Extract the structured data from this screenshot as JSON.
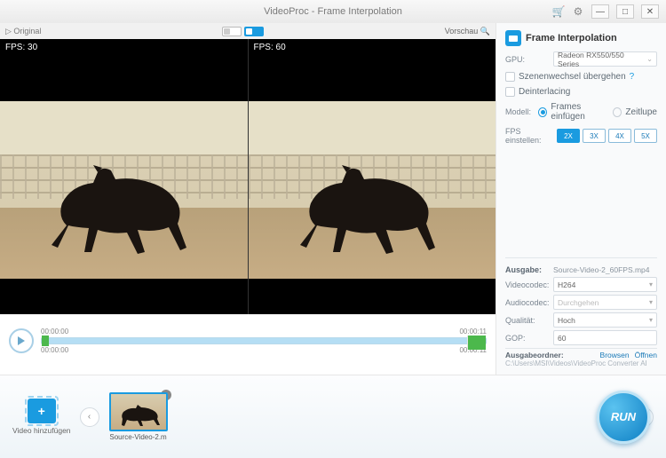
{
  "title": "VideoProc - Frame Interpolation",
  "compare": {
    "original": "Original",
    "preview": "Vorschau"
  },
  "previews": {
    "left_fps": "FPS: 30",
    "right_fps": "FPS: 60"
  },
  "timeline": {
    "start": "00:00:00",
    "end": "00:00:11",
    "sub_start": "00:00:00",
    "sub_end": "00:00:11"
  },
  "panel": {
    "title": "Frame Interpolation",
    "gpu_label": "GPU:",
    "gpu_value": "Radeon RX550/550 Series",
    "scene_skip": "Szenenwechsel übergehen",
    "deinterlacing": "Deinterlacing",
    "model_label": "Modell:",
    "model_insert": "Frames einfügen",
    "model_slowmo": "Zeitlupe",
    "fps_label": "FPS einstellen:",
    "fps_options": {
      "x2": "2X",
      "x3": "3X",
      "x4": "4X",
      "x5": "5X"
    }
  },
  "output": {
    "heading": "Ausgabe:",
    "filename": "Source-Video-2_60FPS.mp4",
    "videocodec_label": "Videocodec:",
    "videocodec_value": "H264",
    "audiocodec_label": "Audiocodec:",
    "audiocodec_value": "Durchgehen",
    "quality_label": "Qualität:",
    "quality_value": "Hoch",
    "gop_label": "GOP:",
    "gop_value": "60",
    "folder_label": "Ausgabeordner:",
    "browse": "Browsen",
    "open": "Öffnen",
    "path": "C:\\Users\\MSI\\Videos\\VideoProc Converter AI"
  },
  "bottom": {
    "add_label": "Video hinzufügen",
    "thumb_name": "Source-Video-2.m",
    "run": "RUN"
  }
}
